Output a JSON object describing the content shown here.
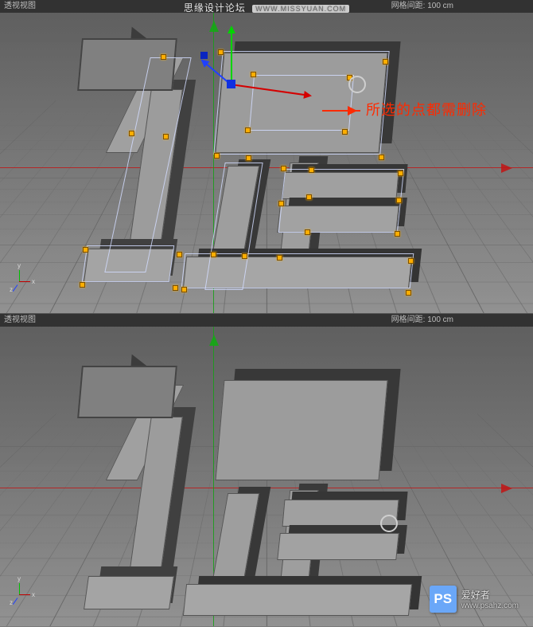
{
  "watermark_top": {
    "site_name": "思缘设计论坛",
    "url": "WWW.MISSYUAN.COM"
  },
  "viewport": {
    "label": "透视视图",
    "grid_info": "网格间距: 100 cm"
  },
  "panel_top": {
    "annotation_text": "所选的点都需删除"
  },
  "mini_axis": {
    "x": "x",
    "y": "y",
    "z": "z"
  },
  "ps_watermark": {
    "logo": "PS",
    "title": "爱好者",
    "url": "www.psahz.com"
  }
}
